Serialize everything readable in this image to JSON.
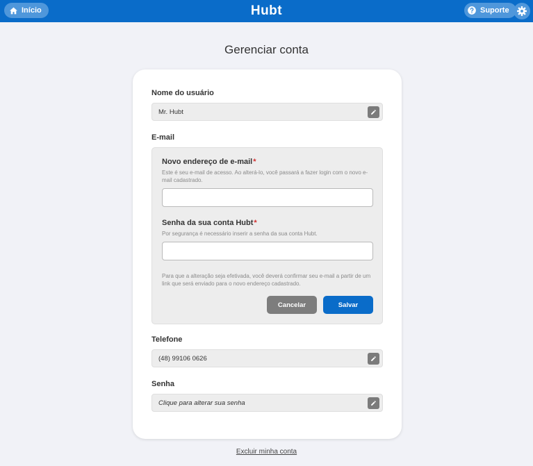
{
  "topbar": {
    "home_label": "Início",
    "logo": "Hubt",
    "support_label": "Suporte",
    "brand_color": "#0a6cc9"
  },
  "page": {
    "title": "Gerenciar conta"
  },
  "account": {
    "username_label": "Nome do usuário",
    "username_value": "Mr. Hubt",
    "email_label": "E-mail",
    "email_form": {
      "new_email_label": "Novo endereço de e-mail",
      "new_email_help": "Este é seu e-mail de acesso. Ao alterá-lo, você passará a fazer login com o novo e-mail cadastrado.",
      "new_email_value": "",
      "password_label": "Senha da sua conta Hubt",
      "password_help": "Por segurança é necessário inserir a senha da sua conta Hubt.",
      "password_value": "",
      "required_mark": "*",
      "notice": "Para que a alteração seja efetivada, você deverá confirmar seu e-mail a partir de um link que será enviado para o novo endereço cadastrado.",
      "cancel_label": "Cancelar",
      "save_label": "Salvar"
    },
    "phone_label": "Telefone",
    "phone_value": "(48) 99106 0626",
    "password_label": "Senha",
    "password_placeholder": "Clique para alterar sua senha"
  },
  "footer": {
    "delete_account_label": "Excluir minha conta"
  }
}
